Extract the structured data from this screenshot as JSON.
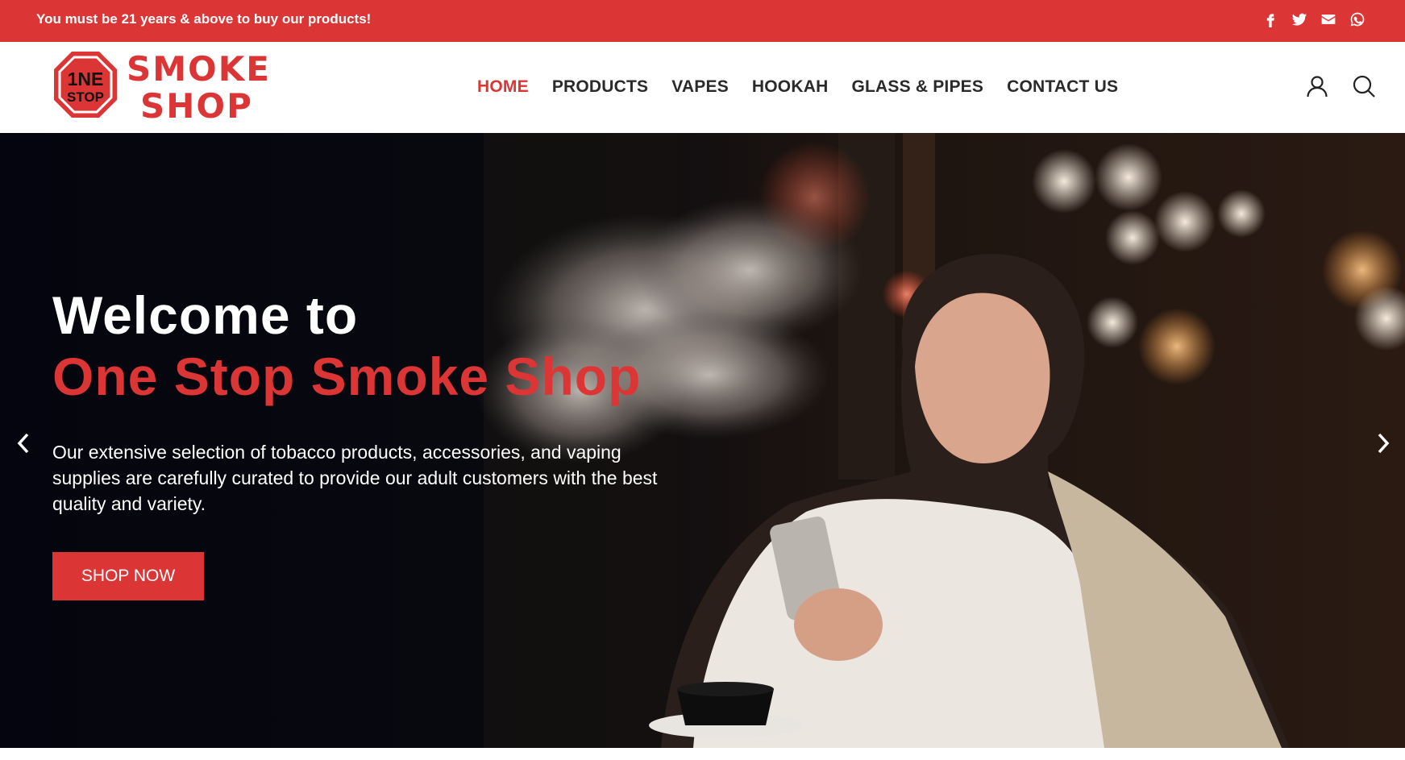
{
  "topbar": {
    "notice": "You must be 21 years & above to buy our products!",
    "social_icons": [
      "facebook-icon",
      "twitter-icon",
      "email-icon",
      "whatsapp-icon"
    ],
    "background_color": "#dc3535"
  },
  "header": {
    "logo": {
      "badge_line1": "1NE",
      "badge_line2": "STOP",
      "word1": "SMOKE",
      "word2": "SHOP"
    },
    "nav": [
      {
        "label": "HOME",
        "active": true
      },
      {
        "label": "PRODUCTS",
        "active": false
      },
      {
        "label": "VAPES",
        "active": false
      },
      {
        "label": "HOOKAH",
        "active": false
      },
      {
        "label": "GLASS & PIPES",
        "active": false
      },
      {
        "label": "CONTACT US",
        "active": false
      }
    ],
    "icons": [
      "user-icon",
      "search-icon"
    ]
  },
  "hero": {
    "title_line1": "Welcome to",
    "title_line2": "One Stop Smoke Shop",
    "text": "Our extensive selection of tobacco products, accessories, and vaping supplies are carefully curated to provide our adult customers with the best quality and variety.",
    "button": "SHOP NOW",
    "accent_color": "#dc3535"
  }
}
